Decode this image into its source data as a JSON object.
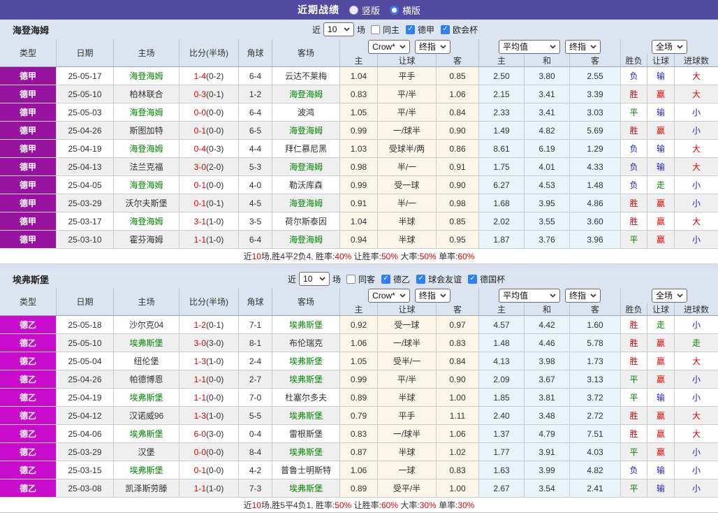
{
  "topbar": {
    "title": "近期战绩",
    "radios": [
      {
        "label": "竖版",
        "selected": false
      },
      {
        "label": "横版",
        "selected": true
      }
    ]
  },
  "colors": {
    "topbar_bg": "#524AA0",
    "bundesliga_badge": "#97129F",
    "bundesliga2_badge": "#C90BCB",
    "self_team_green": "#008A00",
    "win_red": "#E60000",
    "loss_blue": "#2424CC"
  },
  "tables": [
    {
      "team": "海登海姆",
      "league_color": "#97129F",
      "filter": {
        "near": "近",
        "count": "10",
        "unit": "场",
        "checks": [
          {
            "label": "同主",
            "checked": false
          },
          {
            "label": "德甲",
            "checked": true
          },
          {
            "label": "欧会杯",
            "checked": true
          }
        ]
      },
      "header": {
        "cols": [
          "类型",
          "日期",
          "主场",
          "比分(半场)",
          "角球",
          "客场"
        ],
        "company_select": "Crow*",
        "company_stage_select": "终指",
        "avg_select": "平均值",
        "avg_stage_select": "终指",
        "scope_select": "全场",
        "sub": [
          "主",
          "让球",
          "客",
          "主",
          "和",
          "客",
          "胜负",
          "让球",
          "进球数"
        ]
      },
      "rows": [
        {
          "league": "德甲",
          "date": "25-05-17",
          "home": "海登海姆",
          "home_self": true,
          "score": "1-4",
          "half": "(0-2)",
          "corners": "6-4",
          "away": "云达不莱梅",
          "away_self": false,
          "crow": [
            "1.04",
            "平手",
            "0.85"
          ],
          "avg": [
            "2.50",
            "3.80",
            "2.55"
          ],
          "results": [
            "负",
            "输",
            "大"
          ]
        },
        {
          "league": "德甲",
          "date": "25-05-10",
          "home": "柏林联合",
          "home_self": false,
          "score": "0-3",
          "half": "(0-1)",
          "corners": "1-2",
          "away": "海登海姆",
          "away_self": true,
          "crow": [
            "0.83",
            "平/半",
            "1.06"
          ],
          "avg": [
            "2.15",
            "3.41",
            "3.39"
          ],
          "results": [
            "胜",
            "赢",
            "大"
          ]
        },
        {
          "league": "德甲",
          "date": "25-05-03",
          "home": "海登海姆",
          "home_self": true,
          "score": "0-0",
          "half": "(0-0)",
          "corners": "6-4",
          "away": "波鸿",
          "away_self": false,
          "crow": [
            "1.05",
            "平/半",
            "0.84"
          ],
          "avg": [
            "2.33",
            "3.41",
            "3.03"
          ],
          "results": [
            "平",
            "输",
            "小"
          ]
        },
        {
          "league": "德甲",
          "date": "25-04-26",
          "home": "斯图加特",
          "home_self": false,
          "score": "0-1",
          "half": "(0-0)",
          "corners": "6-5",
          "away": "海登海姆",
          "away_self": true,
          "crow": [
            "0.99",
            "一/球半",
            "0.90"
          ],
          "avg": [
            "1.49",
            "4.82",
            "5.69"
          ],
          "results": [
            "胜",
            "赢",
            "小"
          ]
        },
        {
          "league": "德甲",
          "date": "25-04-19",
          "home": "海登海姆",
          "home_self": true,
          "score": "0-4",
          "half": "(0-3)",
          "corners": "4-4",
          "away": "拜仁慕尼黑",
          "away_self": false,
          "crow": [
            "1.03",
            "受球半/两",
            "0.86"
          ],
          "avg": [
            "8.61",
            "6.19",
            "1.29"
          ],
          "results": [
            "负",
            "输",
            "大"
          ]
        },
        {
          "league": "德甲",
          "date": "25-04-13",
          "home": "法兰克福",
          "home_self": false,
          "score": "3-0",
          "half": "(2-0)",
          "corners": "5-3",
          "away": "海登海姆",
          "away_self": true,
          "crow": [
            "0.98",
            "半/一",
            "0.91"
          ],
          "avg": [
            "1.75",
            "4.01",
            "4.33"
          ],
          "results": [
            "负",
            "输",
            "大"
          ]
        },
        {
          "league": "德甲",
          "date": "25-04-05",
          "home": "海登海姆",
          "home_self": true,
          "score": "0-1",
          "half": "(0-0)",
          "corners": "4-0",
          "away": "勒沃库森",
          "away_self": false,
          "crow": [
            "0.99",
            "受一球",
            "0.90"
          ],
          "avg": [
            "6.27",
            "4.53",
            "1.48"
          ],
          "results": [
            "负",
            "走",
            "小"
          ]
        },
        {
          "league": "德甲",
          "date": "25-03-29",
          "home": "沃尔夫斯堡",
          "home_self": false,
          "score": "0-1",
          "half": "(0-1)",
          "corners": "4-5",
          "away": "海登海姆",
          "away_self": true,
          "crow": [
            "0.91",
            "半/一",
            "0.98"
          ],
          "avg": [
            "1.68",
            "3.95",
            "4.86"
          ],
          "results": [
            "胜",
            "赢",
            "小"
          ]
        },
        {
          "league": "德甲",
          "date": "25-03-17",
          "home": "海登海姆",
          "home_self": true,
          "score": "3-1",
          "half": "(1-0)",
          "corners": "3-5",
          "away": "荷尔斯泰因",
          "away_self": false,
          "crow": [
            "1.04",
            "半球",
            "0.85"
          ],
          "avg": [
            "2.02",
            "3.55",
            "3.60"
          ],
          "results": [
            "胜",
            "赢",
            "大"
          ]
        },
        {
          "league": "德甲",
          "date": "25-03-10",
          "home": "霍芬海姆",
          "home_self": false,
          "score": "1-1",
          "half": "(1-0)",
          "corners": "6-4",
          "away": "海登海姆",
          "away_self": true,
          "crow": [
            "0.94",
            "半球",
            "0.95"
          ],
          "avg": [
            "1.87",
            "3.76",
            "3.96"
          ],
          "results": [
            "平",
            "赢",
            "小"
          ]
        }
      ],
      "summary": [
        {
          "t": "近",
          "red": false
        },
        {
          "t": "10",
          "red": true
        },
        {
          "t": "场,胜4平2负4, 胜率:",
          "red": false
        },
        {
          "t": "40%",
          "red": true
        },
        {
          "t": " 让胜率:",
          "red": false
        },
        {
          "t": "50%",
          "red": true
        },
        {
          "t": " 大率:",
          "red": false
        },
        {
          "t": "50%",
          "red": true
        },
        {
          "t": " 单率:",
          "red": false
        },
        {
          "t": "60%",
          "red": true
        }
      ]
    },
    {
      "team": "埃弗斯堡",
      "league_color": "#C90BCB",
      "filter": {
        "near": "近",
        "count": "10",
        "unit": "场",
        "checks": [
          {
            "label": "同客",
            "checked": false
          },
          {
            "label": "德乙",
            "checked": true
          },
          {
            "label": "球会友谊",
            "checked": true
          },
          {
            "label": "德国杯",
            "checked": true
          }
        ]
      },
      "header": {
        "cols": [
          "类型",
          "日期",
          "主场",
          "比分(半场)",
          "角球",
          "客场"
        ],
        "company_select": "Crow*",
        "company_stage_select": "终指",
        "avg_select": "平均值",
        "avg_stage_select": "终指",
        "scope_select": "全场",
        "sub": [
          "主",
          "让球",
          "客",
          "主",
          "和",
          "客",
          "胜负",
          "让球",
          "进球数"
        ]
      },
      "rows": [
        {
          "league": "德乙",
          "date": "25-05-18",
          "home": "沙尔克04",
          "home_self": false,
          "score": "1-2",
          "half": "(0-1)",
          "corners": "7-1",
          "away": "埃弗斯堡",
          "away_self": true,
          "crow": [
            "0.92",
            "受一球",
            "0.97"
          ],
          "avg": [
            "4.57",
            "4.42",
            "1.60"
          ],
          "results": [
            "胜",
            "走",
            "小"
          ]
        },
        {
          "league": "德乙",
          "date": "25-05-10",
          "home": "埃弗斯堡",
          "home_self": true,
          "score": "3-0",
          "half": "(3-0)",
          "corners": "8-1",
          "away": "布伦瑞克",
          "away_self": false,
          "crow": [
            "1.06",
            "一/球半",
            "0.83"
          ],
          "avg": [
            "1.48",
            "4.46",
            "5.78"
          ],
          "results": [
            "胜",
            "赢",
            "走"
          ]
        },
        {
          "league": "德乙",
          "date": "25-05-04",
          "home": "纽伦堡",
          "home_self": false,
          "score": "1-3",
          "half": "(1-0)",
          "corners": "2-4",
          "away": "埃弗斯堡",
          "away_self": true,
          "crow": [
            "1.05",
            "受半/一",
            "0.84"
          ],
          "avg": [
            "4.13",
            "3.98",
            "1.73"
          ],
          "results": [
            "胜",
            "赢",
            "大"
          ]
        },
        {
          "league": "德乙",
          "date": "25-04-26",
          "home": "帕德博恩",
          "home_self": false,
          "score": "1-1",
          "half": "(0-0)",
          "corners": "2-7",
          "away": "埃弗斯堡",
          "away_self": true,
          "crow": [
            "0.99",
            "平/半",
            "0.90"
          ],
          "avg": [
            "2.09",
            "3.67",
            "3.13"
          ],
          "results": [
            "平",
            "赢",
            "小"
          ]
        },
        {
          "league": "德乙",
          "date": "25-04-19",
          "home": "埃弗斯堡",
          "home_self": true,
          "score": "1-1",
          "half": "(0-0)",
          "corners": "7-0",
          "away": "杜塞尔多夫",
          "away_self": false,
          "crow": [
            "0.89",
            "半球",
            "1.00"
          ],
          "avg": [
            "1.85",
            "3.81",
            "3.72"
          ],
          "results": [
            "平",
            "输",
            "小"
          ]
        },
        {
          "league": "德乙",
          "date": "25-04-12",
          "home": "汉诺威96",
          "home_self": false,
          "score": "1-3",
          "half": "(1-0)",
          "corners": "5-5",
          "away": "埃弗斯堡",
          "away_self": true,
          "crow": [
            "0.79",
            "平手",
            "1.11"
          ],
          "avg": [
            "2.40",
            "3.48",
            "2.72"
          ],
          "results": [
            "胜",
            "赢",
            "大"
          ]
        },
        {
          "league": "德乙",
          "date": "25-04-06",
          "home": "埃弗斯堡",
          "home_self": true,
          "score": "6-0",
          "half": "(3-0)",
          "corners": "0-4",
          "away": "雷根斯堡",
          "away_self": false,
          "crow": [
            "0.83",
            "一/球半",
            "1.06"
          ],
          "avg": [
            "1.37",
            "4.79",
            "7.51"
          ],
          "results": [
            "胜",
            "赢",
            "大"
          ]
        },
        {
          "league": "德乙",
          "date": "25-03-29",
          "home": "汉堡",
          "home_self": false,
          "score": "0-0",
          "half": "(0-0)",
          "corners": "8-4",
          "away": "埃弗斯堡",
          "away_self": true,
          "crow": [
            "0.87",
            "半球",
            "1.02"
          ],
          "avg": [
            "1.77",
            "3.91",
            "4.03"
          ],
          "results": [
            "平",
            "赢",
            "小"
          ]
        },
        {
          "league": "德乙",
          "date": "25-03-15",
          "home": "埃弗斯堡",
          "home_self": true,
          "score": "0-1",
          "half": "(0-0)",
          "corners": "4-2",
          "away": "普鲁士明斯特",
          "away_self": false,
          "crow": [
            "1.06",
            "一球",
            "0.83"
          ],
          "avg": [
            "1.63",
            "3.99",
            "4.82"
          ],
          "results": [
            "负",
            "输",
            "小"
          ]
        },
        {
          "league": "德乙",
          "date": "25-03-08",
          "home": "凯泽斯劳滕",
          "home_self": false,
          "score": "1-1",
          "half": "(1-0)",
          "corners": "7-3",
          "away": "埃弗斯堡",
          "away_self": true,
          "crow": [
            "0.89",
            "受平/半",
            "1.00"
          ],
          "avg": [
            "2.67",
            "3.54",
            "2.41"
          ],
          "results": [
            "平",
            "输",
            "小"
          ]
        }
      ],
      "summary": [
        {
          "t": "近",
          "red": false
        },
        {
          "t": "10",
          "red": true
        },
        {
          "t": "场,胜5平4负1, 胜率:",
          "red": false
        },
        {
          "t": "50%",
          "red": true
        },
        {
          "t": " 让胜率:",
          "red": false
        },
        {
          "t": "60%",
          "red": true
        },
        {
          "t": " 大率:",
          "red": false
        },
        {
          "t": "30%",
          "red": true
        },
        {
          "t": " 单率:",
          "red": false
        },
        {
          "t": "30%",
          "red": true
        }
      ]
    }
  ]
}
